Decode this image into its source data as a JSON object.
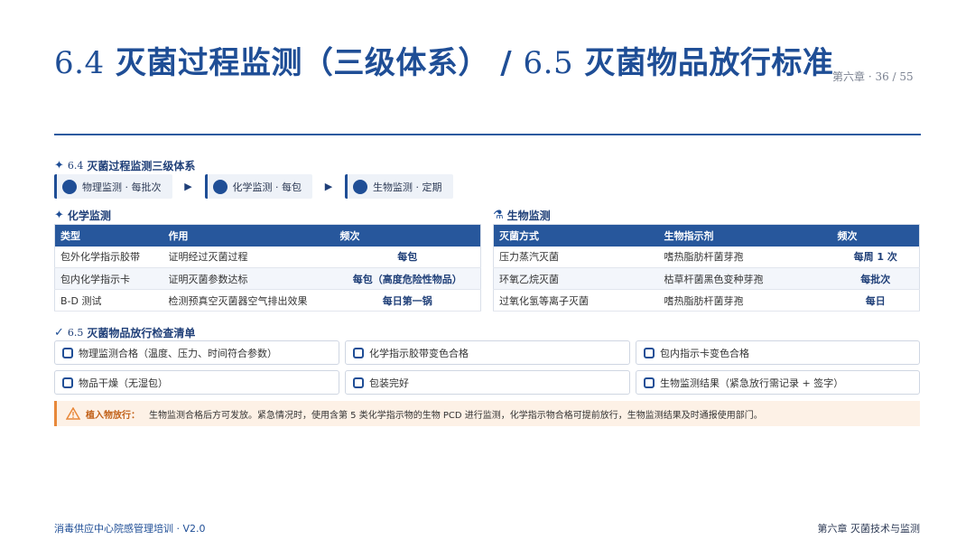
{
  "title": {
    "num1": "6.4",
    "text1": " 灭菌过程监测（三级体系） / ",
    "num2": "6.5",
    "text2": " 灭菌物品放行标准"
  },
  "page": {
    "chapter": "第六章 · 36 / 55"
  },
  "sec64": {
    "num": "6.4",
    "label": "灭菌过程监测三级体系"
  },
  "flow": [
    "物理监测 · 每批次",
    "化学监测 · 每包",
    "生物监测 · 定期"
  ],
  "chem": {
    "heading": "化学监测",
    "headers": [
      "类型",
      "作用",
      "频次"
    ],
    "rows": [
      [
        "包外化学指示胶带",
        "证明经过灭菌过程",
        "每包"
      ],
      [
        "包内化学指示卡",
        "证明灭菌参数达标",
        "每包（高度危险性物品）"
      ],
      [
        "B-D 测试",
        "检测预真空灭菌器空气排出效果",
        "每日第一锅"
      ]
    ]
  },
  "bio": {
    "heading": "生物监测",
    "headers": [
      "灭菌方式",
      "生物指示剂",
      "频次"
    ],
    "rows": [
      [
        "压力蒸汽灭菌",
        "嗜热脂肪杆菌芽孢",
        "每周 1 次"
      ],
      [
        "环氧乙烷灭菌",
        "枯草杆菌黑色变种芽孢",
        "每批次"
      ],
      [
        "过氧化氢等离子灭菌",
        "嗜热脂肪杆菌芽孢",
        "每日"
      ]
    ]
  },
  "sec65": {
    "num": "6.5",
    "label": "灭菌物品放行检查清单"
  },
  "checklist": [
    "物理监测合格（温度、压力、时间符合参数）",
    "化学指示胶带变色合格",
    "包内指示卡变色合格",
    "物品干燥（无湿包）",
    "包装完好",
    "生物监测结果（紧急放行需记录 + 签字）"
  ],
  "note": {
    "lead": "植入物放行：",
    "text": "生物监测合格后方可发放。紧急情况时，使用含第 5 类化学指示物的生物 PCD 进行监测，化学指示物合格可提前放行，生物监测结果及时通报使用部门。"
  },
  "footer": {
    "left": "消毒供应中心院感管理培训 · V2.0",
    "right": "第六章 灭菌技术与监测"
  },
  "colors": {
    "primary": "#1f4e96",
    "warn": "#e8883a",
    "warnBg": "#fdf1e6"
  }
}
